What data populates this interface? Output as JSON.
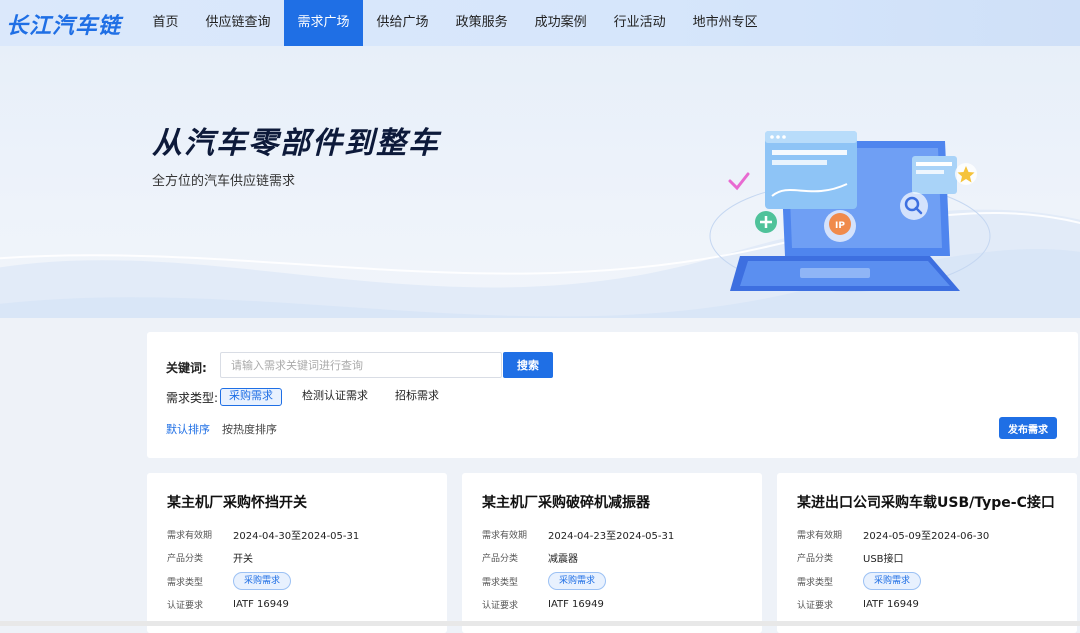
{
  "brand": {
    "logo_text": "长江汽车链",
    "accent": "#1f6fe5"
  },
  "nav": {
    "items": [
      {
        "label": "首页",
        "active": false
      },
      {
        "label": "供应链查询",
        "active": false
      },
      {
        "label": "需求广场",
        "active": true
      },
      {
        "label": "供给广场",
        "active": false
      },
      {
        "label": "政策服务",
        "active": false
      },
      {
        "label": "成功案例",
        "active": false
      },
      {
        "label": "行业活动",
        "active": false
      },
      {
        "label": "地市州专区",
        "active": false
      }
    ]
  },
  "hero": {
    "title": "从汽车零部件到整车",
    "subtitle": "全方位的汽车供应链需求",
    "illustration_icons": [
      "laptop-icon",
      "check-icon",
      "shield-plus-icon",
      "location-pin-icon",
      "search-icon",
      "star-icon"
    ]
  },
  "filter": {
    "keyword_label": "关键词:",
    "search_placeholder": "请输入需求关键词进行查询",
    "search_value": "",
    "search_button": "搜索",
    "type_label": "需求类型:",
    "types": [
      {
        "label": "采购需求",
        "active": true
      },
      {
        "label": "检测认证需求",
        "active": false
      },
      {
        "label": "招标需求",
        "active": false
      }
    ],
    "sort_options": [
      {
        "label": "默认排序",
        "active": true
      },
      {
        "label": "按热度排序",
        "active": false
      }
    ],
    "publish_button": "发布需求"
  },
  "cards": [
    {
      "title": "某主机厂采购怀挡开关",
      "validity_label": "需求有效期",
      "validity": "2024-04-30至2024-05-31",
      "category_label": "产品分类",
      "category": "开关",
      "type_label": "需求类型",
      "type": "采购需求",
      "cert_label": "认证要求",
      "cert": "IATF 16949"
    },
    {
      "title": "某主机厂采购破碎机减振器",
      "validity_label": "需求有效期",
      "validity": "2024-04-23至2024-05-31",
      "category_label": "产品分类",
      "category": "减震器",
      "type_label": "需求类型",
      "type": "采购需求",
      "cert_label": "认证要求",
      "cert": "IATF 16949"
    },
    {
      "title": "某进出口公司采购车载USB/Type-C接口",
      "validity_label": "需求有效期",
      "validity": "2024-05-09至2024-06-30",
      "category_label": "产品分类",
      "category": "USB接口",
      "type_label": "需求类型",
      "type": "采购需求",
      "cert_label": "认证要求",
      "cert": "IATF 16949"
    }
  ]
}
